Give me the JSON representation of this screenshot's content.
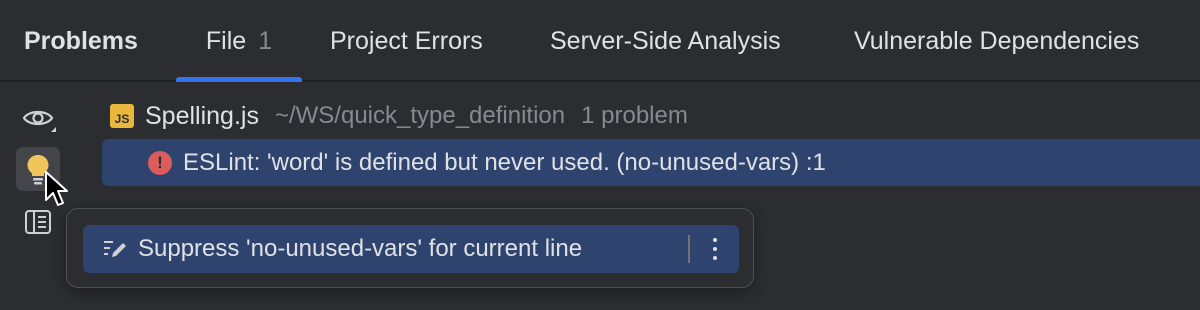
{
  "tabs": {
    "title": "Problems",
    "file_label": "File",
    "file_count": "1",
    "project_errors": "Project Errors",
    "server_side": "Server-Side Analysis",
    "vulnerable": "Vulnerable Dependencies"
  },
  "tree": {
    "file_icon": "JS",
    "file_name": "Spelling.js",
    "file_path": "~/WS/quick_type_definition",
    "problem_count": "1 problem",
    "problem_text": "ESLint: 'word' is defined but never used. (no-unused-vars) :1"
  },
  "popup": {
    "action_label": "Suppress 'no-unused-vars' for current line"
  },
  "toolbar": {
    "icons": [
      "eye-icon",
      "lightbulb-icon",
      "preview-icon"
    ]
  },
  "colors": {
    "background": "#2b2d30",
    "accent": "#3574f0",
    "selection": "#2e436e",
    "error": "#db5c5c",
    "js_badge": "#e8b73c"
  }
}
